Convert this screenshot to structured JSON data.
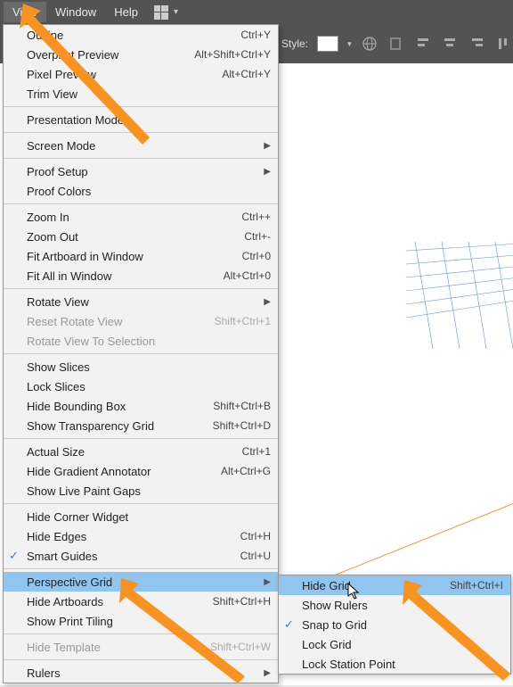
{
  "menubar": {
    "items": [
      "View",
      "Window",
      "Help"
    ]
  },
  "toolbar": {
    "style_label": "Style:"
  },
  "view_menu": {
    "outline": {
      "label": "Outline",
      "shortcut": "Ctrl+Y"
    },
    "overprint": {
      "label": "Overprint Preview",
      "shortcut": "Alt+Shift+Ctrl+Y"
    },
    "pixel": {
      "label": "Pixel Preview",
      "shortcut": "Alt+Ctrl+Y"
    },
    "trim": {
      "label": "Trim View"
    },
    "presentation": {
      "label": "Presentation Mode"
    },
    "screen_mode": {
      "label": "Screen Mode"
    },
    "proof_setup": {
      "label": "Proof Setup"
    },
    "proof_colors": {
      "label": "Proof Colors"
    },
    "zoom_in": {
      "label": "Zoom In",
      "shortcut": "Ctrl++"
    },
    "zoom_out": {
      "label": "Zoom Out",
      "shortcut": "Ctrl+-"
    },
    "fit_artboard": {
      "label": "Fit Artboard in Window",
      "shortcut": "Ctrl+0"
    },
    "fit_all": {
      "label": "Fit All in Window",
      "shortcut": "Alt+Ctrl+0"
    },
    "rotate_view": {
      "label": "Rotate View"
    },
    "reset_rotate": {
      "label": "Reset Rotate View",
      "shortcut": "Shift+Ctrl+1"
    },
    "rotate_sel": {
      "label": "Rotate View To Selection"
    },
    "show_slices": {
      "label": "Show Slices"
    },
    "lock_slices": {
      "label": "Lock Slices"
    },
    "hide_bbox": {
      "label": "Hide Bounding Box",
      "shortcut": "Shift+Ctrl+B"
    },
    "show_transp": {
      "label": "Show Transparency Grid",
      "shortcut": "Shift+Ctrl+D"
    },
    "actual_size": {
      "label": "Actual Size",
      "shortcut": "Ctrl+1"
    },
    "hide_grad": {
      "label": "Hide Gradient Annotator",
      "shortcut": "Alt+Ctrl+G"
    },
    "show_live": {
      "label": "Show Live Paint Gaps"
    },
    "hide_corner": {
      "label": "Hide Corner Widget"
    },
    "hide_edges": {
      "label": "Hide Edges",
      "shortcut": "Ctrl+H"
    },
    "smart_guides": {
      "label": "Smart Guides",
      "shortcut": "Ctrl+U"
    },
    "perspective": {
      "label": "Perspective Grid"
    },
    "hide_artboards": {
      "label": "Hide Artboards",
      "shortcut": "Shift+Ctrl+H"
    },
    "show_print": {
      "label": "Show Print Tiling"
    },
    "hide_template": {
      "label": "Hide Template",
      "shortcut": "Shift+Ctrl+W"
    },
    "rulers": {
      "label": "Rulers"
    }
  },
  "perspective_submenu": {
    "hide_grid": {
      "label": "Hide Grid",
      "shortcut": "Shift+Ctrl+I"
    },
    "show_rulers": {
      "label": "Show Rulers"
    },
    "snap": {
      "label": "Snap to Grid"
    },
    "lock": {
      "label": "Lock Grid"
    },
    "lock_station": {
      "label": "Lock Station Point"
    }
  },
  "annotations": {
    "arrow_color": "#f7931e"
  }
}
